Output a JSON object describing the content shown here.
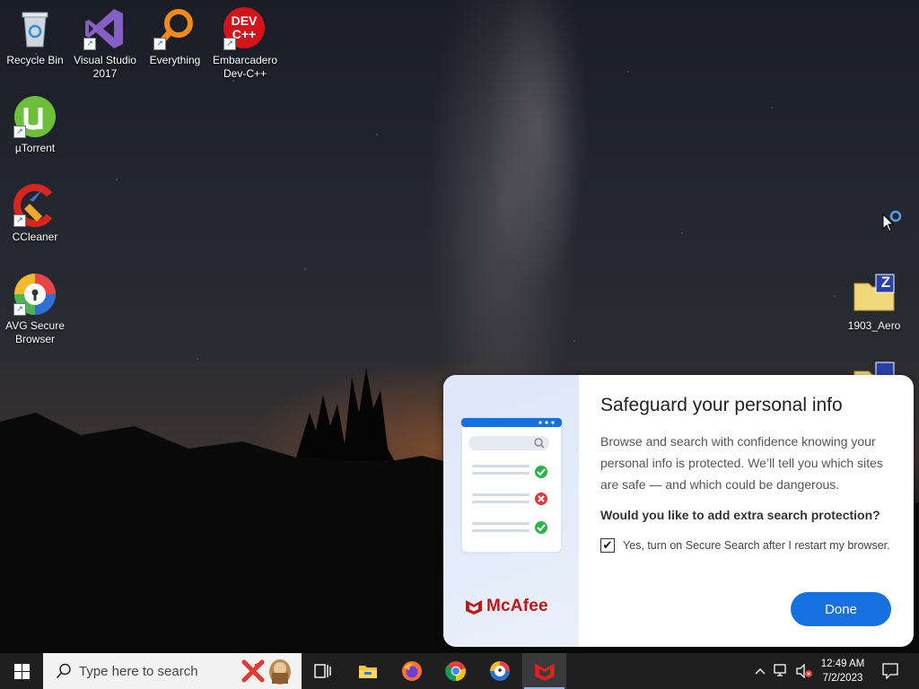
{
  "desktop": {
    "icons": [
      {
        "label": "Recycle Bin"
      },
      {
        "label": "Visual Studio 2017"
      },
      {
        "label": "Everything"
      },
      {
        "label": "Embarcadero Dev-C++"
      },
      {
        "label": "µTorrent"
      },
      {
        "label": "CCleaner"
      },
      {
        "label": "AVG Secure Browser"
      },
      {
        "label": "1903_Aero"
      }
    ],
    "devcpp_glyph_text": "DEV C++",
    "zip_badge": "Z"
  },
  "popup": {
    "title": "Safeguard your personal info",
    "description": "Browse and search with confidence knowing your personal info is protected. We’ll tell you which sites are safe — and which could be dangerous.",
    "question": "Would you like to add extra search protection?",
    "checkbox_label": "Yes, turn on Secure Search after I restart my browser.",
    "checkbox_checked": true,
    "done_label": "Done",
    "brand": "McAfee"
  },
  "taskbar": {
    "search_placeholder": "Type here to search",
    "apps": [
      "task-view",
      "file-explorer",
      "firefox",
      "chrome",
      "avg-secure-browser",
      "mcafee"
    ],
    "time": "12:49 AM",
    "date": "7/2/2023"
  },
  "colors": {
    "accent_blue": "#1671e0",
    "mcafee_red": "#c01818",
    "taskbar": "#1f1f1f"
  }
}
